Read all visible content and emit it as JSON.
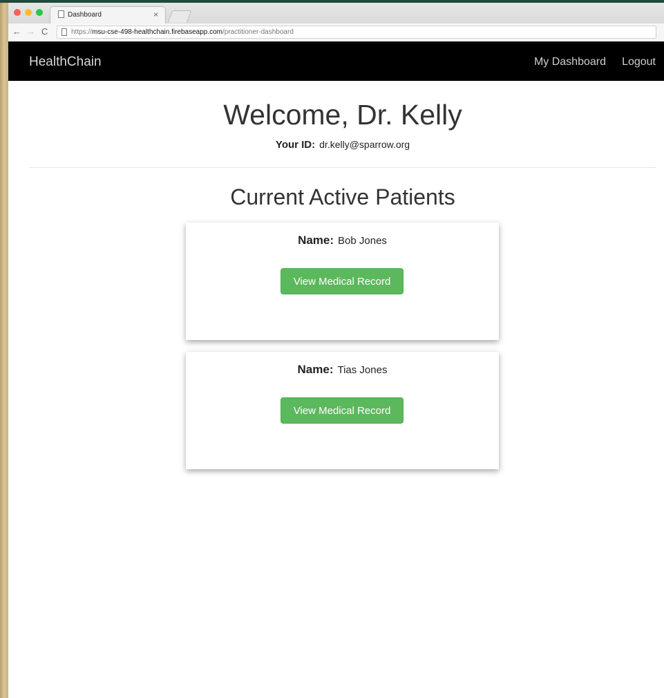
{
  "browser": {
    "tab_title": "Dashboard",
    "tab_close": "×",
    "url_scheme": "https://",
    "url_host": "msu-cse-498-healthchain.firebaseapp.com",
    "url_path": "/practitioner-dashboard",
    "back_glyph": "←",
    "forward_glyph": "→",
    "reload_glyph": "C"
  },
  "navbar": {
    "brand": "HealthChain",
    "links": [
      "My Dashboard",
      "Logout"
    ]
  },
  "header": {
    "welcome": "Welcome, Dr. Kelly",
    "id_label": "Your ID:",
    "id_value": "dr.kelly@sparrow.org"
  },
  "patients": {
    "title": "Current Active Patients",
    "name_label": "Name:",
    "button_label": "View Medical Record",
    "items": [
      {
        "name": "Bob Jones"
      },
      {
        "name": "Tias Jones"
      }
    ]
  },
  "colors": {
    "navbar_bg": "#000000",
    "button_bg": "#5cb85c",
    "traffic_red": "#fc5f57",
    "traffic_yellow": "#fdbc2e",
    "traffic_green": "#28c840"
  }
}
